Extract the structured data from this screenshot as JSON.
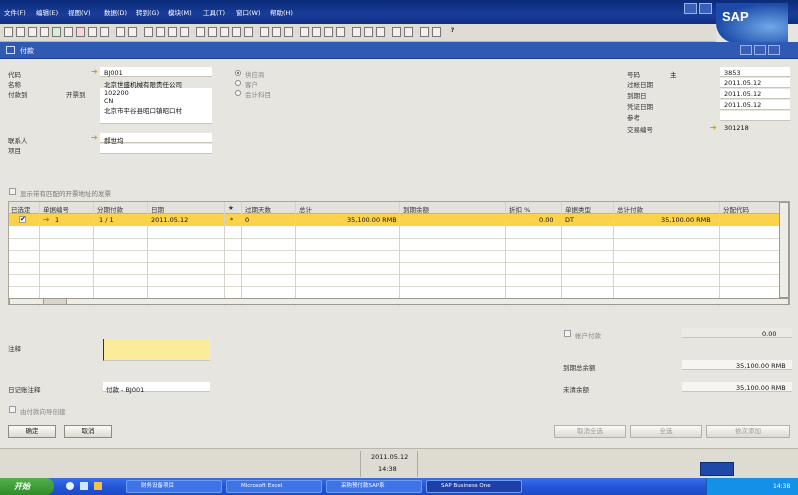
{
  "menu": [
    "文件(F)",
    "编辑(E)",
    "视图(V)",
    "数据(D)",
    "转到(G)",
    "模块(M)",
    "工具(T)",
    "窗口(W)",
    "帮助(H)"
  ],
  "logo": "SAP",
  "window_title": "付款",
  "header": {
    "code_label": "代码",
    "code_value": "BJ001",
    "name_label": "名称",
    "name_value": "北京世盛机械有限责任公司",
    "pay_to_label": "付款到",
    "pay_to_selector": "开票到",
    "address_line1": "102200",
    "address_line2": "CN",
    "address_line3": "北京市平谷县昭口镇昭口村",
    "contact_label": "联系人",
    "contact_value": "郝世均",
    "project_label": "项目",
    "radio_vendor": "供应商",
    "radio_customer": "客户",
    "radio_account": "会计科目",
    "number_label": "号码",
    "number_series": "主",
    "number_value": "3853",
    "posting_date_label": "过帐日期",
    "posting_date_value": "2011.05.12",
    "due_date_label": "到期日",
    "due_date_value": "2011.05.12",
    "doc_date_label": "凭证日期",
    "doc_date_value": "2011.05.12",
    "reference_label": "参考",
    "trans_no_label": "交易编号",
    "trans_no_value": "301218"
  },
  "show_invoices_label": "显示带有匹配的开票地址的发票",
  "grid": {
    "columns": [
      "已选定",
      "单据编号",
      "分期付款",
      "日期",
      "★",
      "过期天数",
      "总计",
      "到期余额",
      "折扣 %",
      "单据类型",
      "总计付款",
      "分配代码"
    ],
    "row": {
      "doc_no": "1",
      "installment": "1 / 1",
      "date": "2011.05.12",
      "star": "*",
      "overdue_days": "0",
      "total": "35,100.00 RMB",
      "discount": "0.00",
      "doc_type": "DT",
      "total_payment": "35,100.00 RMB"
    }
  },
  "footer": {
    "remarks_label": "注释",
    "journal_remarks_label": "日记账注释",
    "journal_remarks_value": "付款 - BJ001",
    "wizard_label": "由付款向导创建",
    "account_payment_label": "帐户付款",
    "account_payment_value": "0.00",
    "due_balance_label": "到期总余额",
    "due_balance_value": "35,100.00 RMB",
    "open_balance_label": "未清余额",
    "open_balance_value": "35,100.00 RMB",
    "ok_button": "确定",
    "cancel_button": "取消",
    "deselect_all_button": "取消全选",
    "select_all_button": "全选",
    "add_in_sequence_button": "依次添加"
  },
  "status": {
    "date": "2011.05.12",
    "time": "14:38"
  },
  "taskbar": {
    "start": "开始",
    "tasks": [
      "财务设备项目",
      "Microsoft Excel",
      "采购预付款SAP系",
      "SAP Business One"
    ],
    "clock": "14:38"
  }
}
